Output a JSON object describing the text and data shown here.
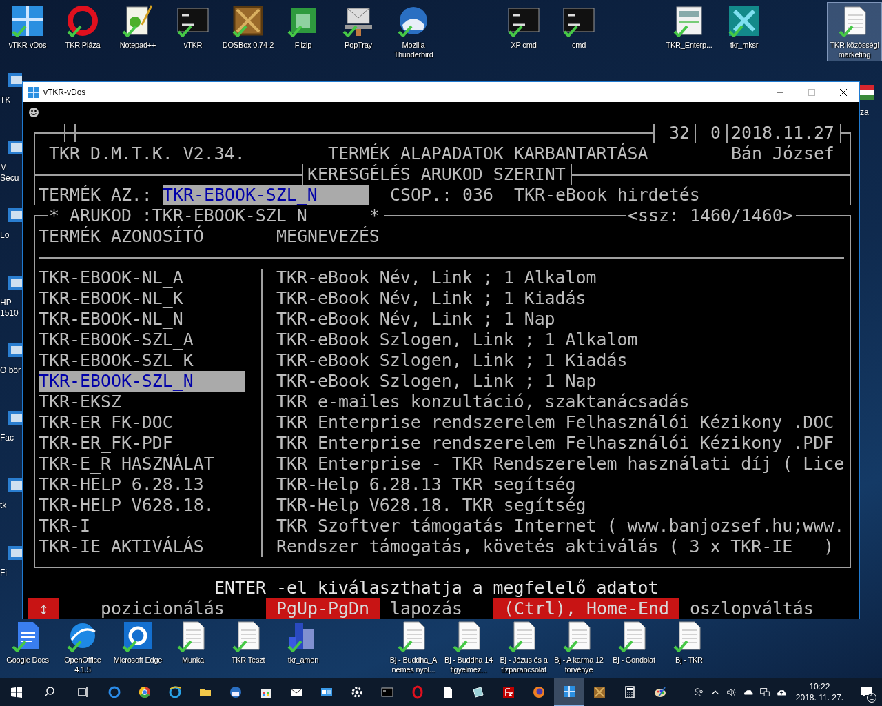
{
  "desktop": {
    "top_icons": [
      {
        "label": "vTKR-vDos",
        "selected": false
      },
      {
        "label": "TKR Pláza",
        "selected": false
      },
      {
        "label": "Notepad++",
        "selected": false
      },
      {
        "label": "vTKR",
        "selected": false
      },
      {
        "label": "DOSBox 0.74-2",
        "selected": false
      },
      {
        "label": "Filzip",
        "selected": false
      },
      {
        "label": "PopTray",
        "selected": false
      },
      {
        "label": "Mozilla Thunderbird",
        "selected": false
      },
      {
        "label": "XP cmd",
        "selected": false
      },
      {
        "label": "cmd",
        "selected": false
      },
      {
        "label": "TKR_Enterp...",
        "selected": false
      },
      {
        "label": "tkr_mksr",
        "selected": false
      },
      {
        "label": "TKR közösségi marketing",
        "selected": true
      }
    ],
    "left_icons": [
      {
        "label": "TK"
      },
      {
        "label": "M Secu"
      },
      {
        "label": "Lo"
      },
      {
        "label": "HP 1510"
      },
      {
        "label": "O bör"
      },
      {
        "label": "Fac"
      },
      {
        "label": "tk"
      },
      {
        "label": "Fi"
      }
    ],
    "right_icons": [
      {
        "label": "za"
      }
    ],
    "bottom_icons": [
      {
        "label": "Google Docs",
        "selected": false
      },
      {
        "label": "OpenOffice 4.1.5",
        "selected": false
      },
      {
        "label": "Microsoft Edge",
        "selected": false
      },
      {
        "label": "Munka",
        "selected": false
      },
      {
        "label": "TKR Teszt",
        "selected": false
      },
      {
        "label": "tkr_amen",
        "selected": false
      },
      {
        "label": "Bj - Buddha_A nemes nyol...",
        "selected": false
      },
      {
        "label": "Bj - Buddha 14 figyelmez...",
        "selected": false
      },
      {
        "label": "Bj - Jézus és a tízparancsolat",
        "selected": false
      },
      {
        "label": "Bj - A karma 12 törvénye",
        "selected": false
      },
      {
        "label": "Bj - Gondolat",
        "selected": false
      },
      {
        "label": "Bj - TKR",
        "selected": false
      }
    ]
  },
  "window": {
    "title": "vTKR-vDos"
  },
  "header": {
    "counter_1": "32",
    "counter_2": "0",
    "date": "2018.11.27",
    "app_version": "TKR D.M.T.K. V2.34.",
    "screen_title": "TERMÉK ALAPADATOK KARBANTARTÁSA",
    "user": "Bán József",
    "mode": "KERESGÉLÉS ARUKOD SZERINT"
  },
  "search": {
    "label": "TERMÉK AZ.:",
    "value": "TKR-EBOOK-SZL_N",
    "group_label": "CSOP.:",
    "group_code": "036",
    "group_name": "TKR-eBook hirdetés"
  },
  "list": {
    "filter": "* ARUKOD :TKR-EBOOK-SZL_N",
    "filter_end": "*",
    "position": "<ssz: 1460/1460>",
    "columns": [
      "TERMÉK AZONOSÍTÓ",
      "MEGNEVEZÉS"
    ],
    "rows": [
      {
        "id": "TKR-EBOOK-NL_A",
        "name": "TKR-eBook Név, Link ; 1 Alkalom",
        "selected": false
      },
      {
        "id": "TKR-EBOOK-NL_K",
        "name": "TKR-eBook Név, Link ; 1 Kiadás",
        "selected": false
      },
      {
        "id": "TKR-EBOOK-NL_N",
        "name": "TKR-eBook Név, Link ; 1 Nap",
        "selected": false
      },
      {
        "id": "TKR-EBOOK-SZL_A",
        "name": "TKR-eBook Szlogen, Link ; 1 Alkalom",
        "selected": false
      },
      {
        "id": "TKR-EBOOK-SZL_K",
        "name": "TKR-eBook Szlogen, Link ; 1 Kiadás",
        "selected": false
      },
      {
        "id": "TKR-EBOOK-SZL_N",
        "name": "TKR-eBook Szlogen, Link ; 1 Nap",
        "selected": true
      },
      {
        "id": "TKR-EKSZ",
        "name": "TKR e-mailes konzultáció, szaktanácsadás",
        "selected": false
      },
      {
        "id": "TKR-ER_FK-DOC",
        "name": "TKR Enterprise rendszerelem Felhasználói Kézikony .DOC",
        "selected": false
      },
      {
        "id": "TKR-ER_FK-PDF",
        "name": "TKR Enterprise rendszerelem Felhasználói Kézikony .PDF",
        "selected": false
      },
      {
        "id": "TKR-E_R HASZNÁLAT",
        "name": "TKR Enterprise - TKR Rendszerelem használati díj ( Lice",
        "selected": false
      },
      {
        "id": "TKR-HELP 6.28.13",
        "name": "TKR-Help 6.28.13 TKR segítség",
        "selected": false
      },
      {
        "id": "TKR-HELP V628.18.",
        "name": "TKR-Help V628.18. TKR segítség",
        "selected": false
      },
      {
        "id": "TKR-I",
        "name": "TKR Szoftver támogatás Internet ( www.banjozsef.hu;www.",
        "selected": false
      },
      {
        "id": "TKR-IE AKTIVÁLÁS",
        "name": "Rendszer támogatás, követés aktiválás ( 3 x TKR-IE   )",
        "selected": false
      }
    ]
  },
  "footer": {
    "hint": "ENTER -el kiválaszthatja a megfelelő adatot",
    "keys": [
      {
        "key": "↕",
        "action": "pozicionálás"
      },
      {
        "key": "PgUp-PgDn",
        "action": "lapozás"
      },
      {
        "key": "(Ctrl), Home-End",
        "action": "oszlopváltás"
      }
    ]
  },
  "taskbar": {
    "apps": [
      {
        "selected": false
      },
      {
        "selected": false
      },
      {
        "selected": false
      },
      {
        "selected": false
      },
      {
        "selected": false
      },
      {
        "selected": false
      },
      {
        "selected": false
      },
      {
        "selected": false
      },
      {
        "selected": false
      },
      {
        "selected": false
      },
      {
        "selected": false
      },
      {
        "selected": false
      },
      {
        "selected": false
      },
      {
        "selected": false
      },
      {
        "selected": false
      },
      {
        "selected": true
      },
      {
        "selected": false
      },
      {
        "selected": false
      },
      {
        "selected": false
      }
    ],
    "time": "10:22",
    "date": "2018. 11. 27.",
    "notification_count": "1"
  }
}
